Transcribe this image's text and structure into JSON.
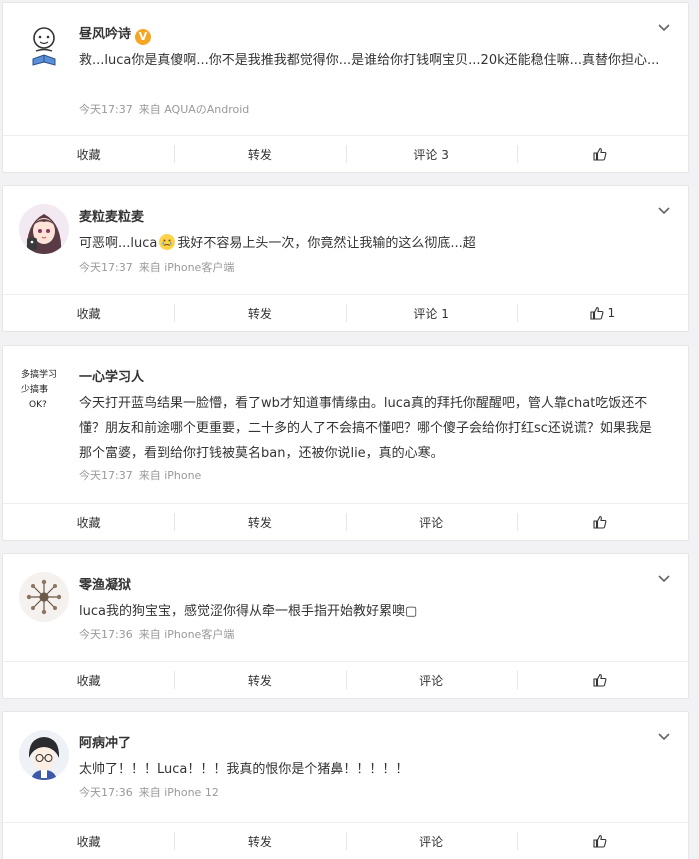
{
  "posts": [
    {
      "username": "昼风吟诗",
      "verified": true,
      "verified_badge": "V",
      "avatar_icon": "cartoon-reading-person-avatar",
      "content": "救...luca你是真傻啊...你不是我推我都觉得你...是谁给你打钱啊宝贝...20k还能稳住嘛...真替你担心...",
      "time": "今天17:37",
      "source": "来自 AQUAのAndroid",
      "actions": {
        "collect": "收藏",
        "repost": "转发",
        "comment": "评论 3",
        "like_count": ""
      }
    },
    {
      "username": "麦粒麦粒麦",
      "avatar_icon": "anime-girl-avatar",
      "content_before": "可恶啊...luca",
      "content_emoji": "crying-face-emoji",
      "content_after": "我好不容易上头一次，你竟然让我输的这么彻底...超",
      "time": "今天17:37",
      "source": "来自 iPhone客户端",
      "actions": {
        "collect": "收藏",
        "repost": "转发",
        "comment": "评论 1",
        "like_count": "1"
      }
    },
    {
      "username": "一心学习人",
      "avatar_icon": "handwritten-text-avatar",
      "avatar_text": [
        "多搞学习",
        "少搞事",
        "OK?"
      ],
      "content": "今天打开蓝鸟结果一脸懵，看了wb才知道事情缘由。luca真的拜托你醒醒吧，管人靠chat吃饭还不懂？朋友和前途哪个更重要，二十多的人了不会搞不懂吧？哪个傻子会给你打红sc还说谎？如果我是那个富婆，看到给你打钱被莫名ban，还被你说lie，真的心寒。",
      "time": "今天17:37",
      "source": "来自 iPhone",
      "actions": {
        "collect": "收藏",
        "repost": "转发",
        "comment": "评论",
        "like_count": ""
      }
    },
    {
      "username": "零渔凝狱",
      "avatar_icon": "mandala-pattern-avatar",
      "content": "luca我的狗宝宝，感觉涩你得从牵一根手指开始教好累噢▢",
      "time": "今天17:36",
      "source": "来自 iPhone客户端",
      "actions": {
        "collect": "收藏",
        "repost": "转发",
        "comment": "评论",
        "like_count": ""
      }
    },
    {
      "username": "阿病冲了",
      "avatar_icon": "anime-boy-glasses-avatar",
      "content": "太帅了！！！Luca！！！我真的恨你是个猪鼻！！！！！",
      "time": "今天17:36",
      "source": "来自 iPhone 12",
      "actions": {
        "collect": "收藏",
        "repost": "转发",
        "comment": "评论",
        "like_count": ""
      }
    }
  ]
}
